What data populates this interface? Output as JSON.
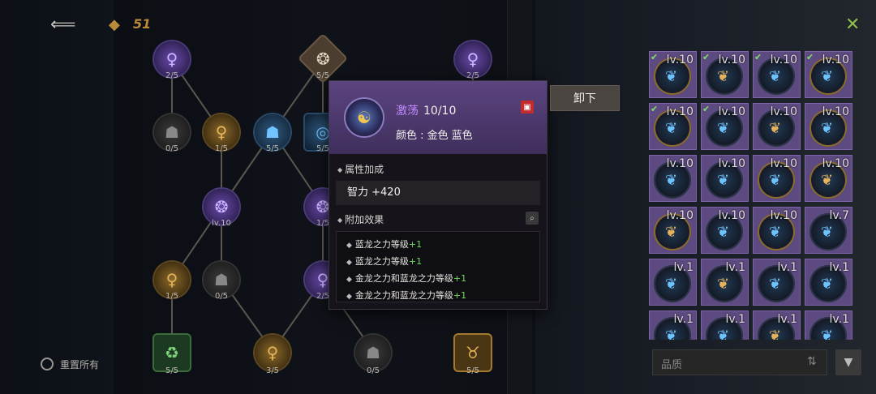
{
  "top": {
    "back_icon": "back-arrow-icon",
    "currency_icon": "gem-icon",
    "currency_value": "51",
    "close_icon": "close-x-icon"
  },
  "tree": {
    "counts": [
      "2/5",
      "5/5",
      "2/5",
      "0/5",
      "1/5",
      "5/5",
      "5/5",
      "lv.10",
      "1/5",
      "1/5",
      "0/5",
      "2/5",
      "5/5",
      "3/5",
      "0/5",
      "5/5"
    ]
  },
  "popup": {
    "item_name": "激荡",
    "item_level": "10/10",
    "item_color": "颜色 : 金色 蓝色",
    "lock_icon": "lock-icon",
    "attr_title": "属性加成",
    "attr_value": "智力 +420",
    "extra_title": "附加效果",
    "extra_icon": "magnify-icon",
    "effects": [
      {
        "text": "蓝龙之力等级",
        "plus": "+1"
      },
      {
        "text": "蓝龙之力等级",
        "plus": "+1"
      },
      {
        "text": "金龙之力和蓝龙之力等级",
        "plus": "+1"
      },
      {
        "text": "金龙之力和蓝龙之力等级",
        "plus": "+1"
      }
    ]
  },
  "unequip_label": "卸下",
  "inventory": {
    "levels": [
      "lv.10",
      "lv.10",
      "lv.10",
      "lv.10",
      "lv.10",
      "lv.10",
      "lv.10",
      "lv.10",
      "lv.10",
      "lv.10",
      "lv.10",
      "lv.10",
      "lv.10",
      "lv.10",
      "lv.10",
      "lv.7",
      "lv.1",
      "lv.1",
      "lv.1",
      "lv.1",
      "lv.1",
      "lv.1",
      "lv.1",
      "lv.1"
    ]
  },
  "filter": {
    "label": "品质",
    "sort_icon": "sort-icon",
    "funnel_icon": "filter-funnel-icon"
  },
  "reset_label": "重置所有",
  "colors": {
    "accent_purple": "#c28cff",
    "plus_green": "#6ddc5a",
    "cell_purple": "#5d4a80"
  }
}
